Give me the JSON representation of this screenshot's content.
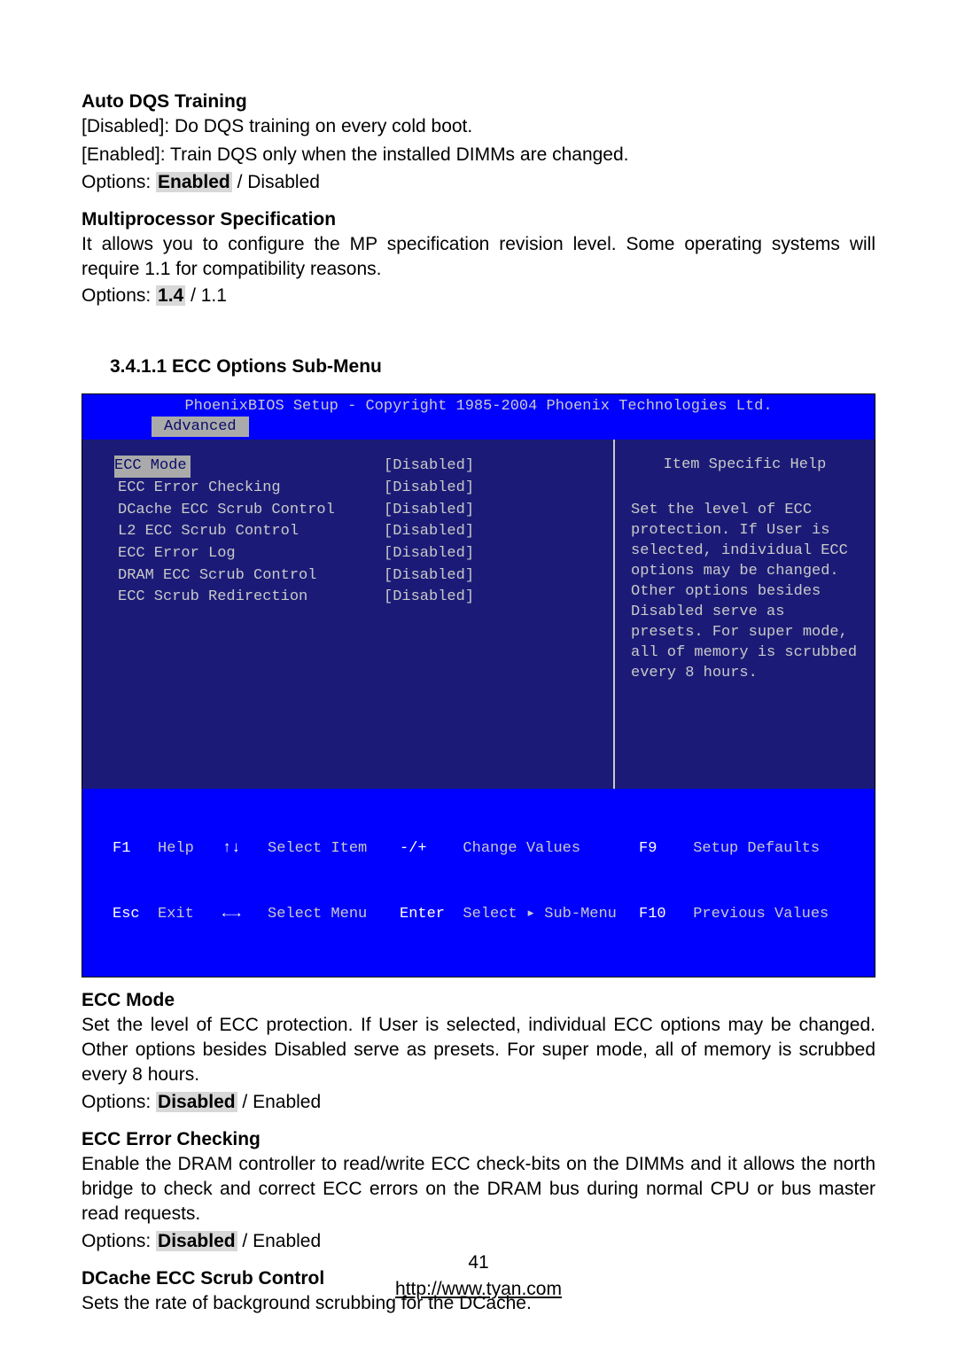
{
  "autoDqs": {
    "heading": "Auto DQS Training",
    "line1": "[Disabled]: Do DQS training on every cold boot.",
    "line2": "[Enabled]: Train DQS only when the installed DIMMs are changed.",
    "optsPrefix": "Options: ",
    "optsDefault": "Enabled",
    "optsRest": " / Disabled"
  },
  "mpSpec": {
    "heading": "Multiprocessor Specification",
    "body": "It allows you to configure the MP specification revision level.  Some operating systems will require 1.1 for compatibility reasons.",
    "optsPrefix": "Options: ",
    "optsDefault": "1.4",
    "optsRest": " / 1.1"
  },
  "submenuHeading": "3.4.1.1  ECC Options Sub-Menu",
  "bios": {
    "title": "PhoenixBIOS Setup - Copyright 1985-2004 Phoenix Technologies Ltd.",
    "tab": "Advanced",
    "items": [
      {
        "label": "ECC Mode",
        "value": "[Disabled]",
        "selected": true
      },
      {
        "label": "ECC Error Checking",
        "value": "[Disabled]"
      },
      {
        "label": "DCache ECC Scrub Control",
        "value": "[Disabled]"
      },
      {
        "label": "L2 ECC Scrub Control",
        "value": "[Disabled]"
      },
      {
        "label": "ECC Error Log",
        "value": "[Disabled]"
      },
      {
        "label": "DRAM ECC Scrub Control",
        "value": "[Disabled]"
      },
      {
        "label": "ECC Scrub Redirection",
        "value": "[Disabled]"
      }
    ],
    "helpTitle": "Item Specific Help",
    "helpBody": "Set the level of ECC protection. If User is selected, individual ECC options may be changed. Other options besides Disabled serve as presets. For super mode, all of memory is scrubbed every 8 hours.",
    "footer": {
      "f1": "F1",
      "help": "Help",
      "esc": "Esc",
      "exit": "Exit",
      "ud": "↑↓",
      "selItem": "Select Item",
      "lr": "←→",
      "selMenu": "Select Menu",
      "pm": "-/+",
      "chg": "Change Values",
      "enter": "Enter",
      "sub": "Select ▸ Sub-Menu",
      "f9": "F9",
      "setup": "Setup Defaults",
      "f10": "F10",
      "prev": "Previous Values"
    }
  },
  "eccMode": {
    "heading": "ECC Mode",
    "body": "Set the level of ECC protection.  If User is selected, individual ECC options may be changed.  Other options besides Disabled serve as presets.  For super mode, all of memory is scrubbed every 8 hours.",
    "optsPrefix": "Options: ",
    "optsDefault": "Disabled",
    "optsRest": " / Enabled"
  },
  "eccErr": {
    "heading": "ECC Error Checking",
    "body": "Enable the DRAM controller to read/write ECC check-bits on the DIMMs and it allows the north bridge to check and correct ECC errors on the DRAM bus during normal CPU or bus master read requests.",
    "optsPrefix": "Options: ",
    "optsDefault": "Disabled",
    "optsRest": " / Enabled"
  },
  "dcache": {
    "heading": "DCache ECC Scrub Control",
    "body": "Sets the rate of background scrubbing for the DCache."
  },
  "footer": {
    "pageNum": "41",
    "url": "http://www.tyan.com"
  }
}
